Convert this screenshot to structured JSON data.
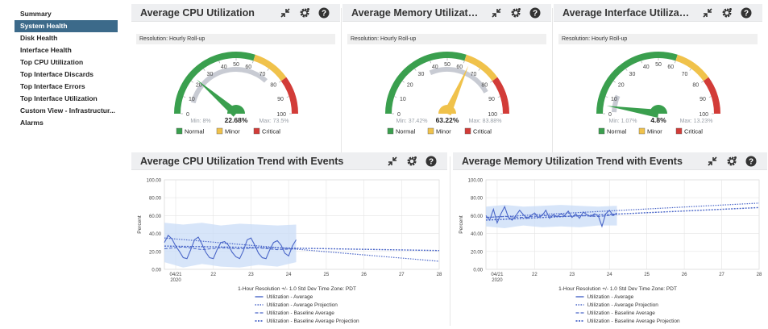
{
  "sidebar": {
    "items": [
      {
        "label": "Summary",
        "active": false
      },
      {
        "label": "System Health",
        "active": true
      },
      {
        "label": "Disk Health",
        "active": false
      },
      {
        "label": "Interface Health",
        "active": false
      },
      {
        "label": "Top CPU Utilization",
        "active": false
      },
      {
        "label": "Top Interface Discards",
        "active": false
      },
      {
        "label": "Top Interface Errors",
        "active": false
      },
      {
        "label": "Top Interface Utilization",
        "active": false
      },
      {
        "label": "Custom View - Infrastructur...",
        "active": false
      },
      {
        "label": "Alarms",
        "active": false
      }
    ]
  },
  "colors": {
    "normal": "#3a9f4e",
    "minor": "#f0c24b",
    "critical": "#d23c38",
    "active_nav": "#3c6a8a",
    "series": "#4a66c8",
    "band": "#c9dcf7"
  },
  "icons": [
    "expand-icon",
    "gear-icon",
    "help-icon"
  ],
  "gauges": [
    {
      "title": "Average CPU Utilization",
      "resolution": "Resolution: Hourly Roll-up",
      "value": 22.68,
      "value_label": "22.68%",
      "min": 8,
      "min_label": "Min: 8%",
      "max": 73.5,
      "max_label": "Max: 73.5%",
      "needle_color": "#3a9f4e",
      "ticks": [
        "0",
        "10",
        "20",
        "30",
        "40",
        "50",
        "60",
        "70",
        "80",
        "90",
        "100"
      ],
      "legend": [
        "Normal",
        "Minor",
        "Critical"
      ]
    },
    {
      "title": "Average Memory Utilization",
      "resolution": "Resolution: Hourly Roll-up",
      "value": 63.22,
      "value_label": "63.22%",
      "min": 37.42,
      "min_label": "Min: 37.42%",
      "max": 83.88,
      "max_label": "Max: 83.88%",
      "needle_color": "#f0c24b",
      "ticks": [
        "0",
        "10",
        "20",
        "30",
        "40",
        "50",
        "60",
        "70",
        "80",
        "90",
        "100"
      ],
      "legend": [
        "Normal",
        "Minor",
        "Critical"
      ]
    },
    {
      "title": "Average Interface Utilizatio...",
      "resolution": "Resolution: Hourly Roll-up",
      "value": 4.8,
      "value_label": "4.8%",
      "min": 1.07,
      "min_label": "Min: 1.07%",
      "max": 13.23,
      "max_label": "Max: 13.23%",
      "needle_color": "#3a9f4e",
      "ticks": [
        "0",
        "10",
        "20",
        "30",
        "40",
        "50",
        "60",
        "70",
        "80",
        "90",
        "100"
      ],
      "legend": [
        "Normal",
        "Minor",
        "Critical"
      ]
    }
  ],
  "chart_data": [
    {
      "type": "line",
      "title": "Average CPU Utilization Trend with Events",
      "ylabel": "Percent",
      "ylim": [
        0,
        100
      ],
      "yticks": [
        "0.00",
        "20.00",
        "40.00",
        "60.00",
        "80.00",
        "100.00"
      ],
      "xticks": [
        "04/21",
        "22",
        "23",
        "24",
        "25",
        "26",
        "27",
        "28"
      ],
      "xtick_sub": "2020",
      "grid": true,
      "footer": "1-Hour Resolution +/- 1.0 Std Dev Time Zone: PDT",
      "legend": [
        "Utilization - Average",
        "Utilization - Average Projection",
        "Utilization - Baseline Average",
        "Utilization - Baseline Average Projection"
      ],
      "series": [
        {
          "name": "Utilization - Average",
          "x": [
            0,
            0.1,
            0.2,
            0.3,
            0.4,
            0.5,
            0.6,
            0.7,
            0.8,
            0.9,
            1,
            1.1,
            1.2,
            1.3,
            1.4,
            1.5,
            1.6,
            1.7,
            1.8,
            1.9,
            2,
            2.1,
            2.2,
            2.3,
            2.4,
            2.5,
            2.6,
            2.7,
            2.8,
            2.9,
            3,
            3.1,
            3.2,
            3.3,
            3.4,
            3.5
          ],
          "y": [
            30,
            38,
            34,
            26,
            20,
            13,
            12,
            22,
            33,
            36,
            28,
            19,
            13,
            12,
            22,
            30,
            31,
            27,
            19,
            14,
            12,
            21,
            33,
            35,
            27,
            18,
            13,
            12,
            22,
            30,
            32,
            27,
            18,
            15,
            26,
            33
          ]
        },
        {
          "name": "Utilization - Average Projection",
          "x": [
            0,
            7.3
          ],
          "y": [
            35,
            9
          ]
        },
        {
          "name": "Utilization - Baseline Average",
          "x": [
            0,
            0.5,
            1,
            1.5,
            2,
            2.5,
            3,
            3.5
          ],
          "y": [
            23,
            25,
            22,
            24,
            23,
            24,
            22,
            23
          ]
        },
        {
          "name": "Utilization - Baseline Average Projection",
          "x": [
            0,
            7.3
          ],
          "y": [
            26,
            21
          ]
        }
      ],
      "band": {
        "x": [
          0,
          0.5,
          1,
          1.5,
          2,
          2.5,
          3,
          3.5
        ],
        "upper": [
          52,
          50,
          52,
          49,
          51,
          50,
          49,
          50
        ],
        "lower": [
          8,
          2,
          6,
          3,
          2,
          5,
          3,
          8
        ]
      }
    },
    {
      "type": "line",
      "title": "Average Memory Utilization Trend with Events",
      "ylabel": "Percent",
      "ylim": [
        0,
        100
      ],
      "yticks": [
        "0.00",
        "20.00",
        "40.00",
        "60.00",
        "80.00",
        "100.00"
      ],
      "xticks": [
        "04/21",
        "22",
        "23",
        "24",
        "25",
        "26",
        "27",
        "28"
      ],
      "xtick_sub": "2020",
      "grid": true,
      "footer": "1-Hour Resolution +/- 1.0 Std Dev Time Zone: PDT",
      "legend": [
        "Utilization - Average",
        "Utilization - Average Projection",
        "Utilization - Baseline Average",
        "Utilization - Baseline Average Projection"
      ],
      "series": [
        {
          "name": "Utilization - Average",
          "x": [
            0,
            0.1,
            0.2,
            0.3,
            0.4,
            0.5,
            0.6,
            0.7,
            0.8,
            0.9,
            1,
            1.1,
            1.2,
            1.3,
            1.4,
            1.5,
            1.6,
            1.7,
            1.8,
            1.9,
            2,
            2.1,
            2.2,
            2.3,
            2.4,
            2.5,
            2.6,
            2.7,
            2.8,
            2.9,
            3,
            3.1,
            3.2,
            3.3,
            3.4,
            3.5
          ],
          "y": [
            60,
            55,
            67,
            52,
            62,
            70,
            58,
            55,
            60,
            66,
            61,
            57,
            60,
            63,
            58,
            60,
            66,
            57,
            61,
            59,
            62,
            60,
            65,
            58,
            62,
            57,
            64,
            61,
            59,
            62,
            60,
            48,
            62,
            66,
            60,
            63
          ]
        },
        {
          "name": "Utilization - Average Projection",
          "x": [
            0,
            7.3
          ],
          "y": [
            58,
            74
          ]
        },
        {
          "name": "Utilization - Baseline Average",
          "x": [
            0,
            0.5,
            1,
            1.5,
            2,
            2.5,
            3,
            3.5
          ],
          "y": [
            58,
            59,
            58,
            60,
            59,
            60,
            59,
            61
          ]
        },
        {
          "name": "Utilization - Baseline Average Projection",
          "x": [
            0,
            7.3
          ],
          "y": [
            55,
            69
          ]
        }
      ],
      "band": {
        "x": [
          0,
          0.5,
          1,
          1.5,
          2,
          2.5,
          3,
          3.5
        ],
        "upper": [
          70,
          72,
          70,
          71,
          72,
          71,
          70,
          71
        ],
        "lower": [
          48,
          46,
          49,
          47,
          48,
          47,
          49,
          49
        ]
      }
    }
  ]
}
